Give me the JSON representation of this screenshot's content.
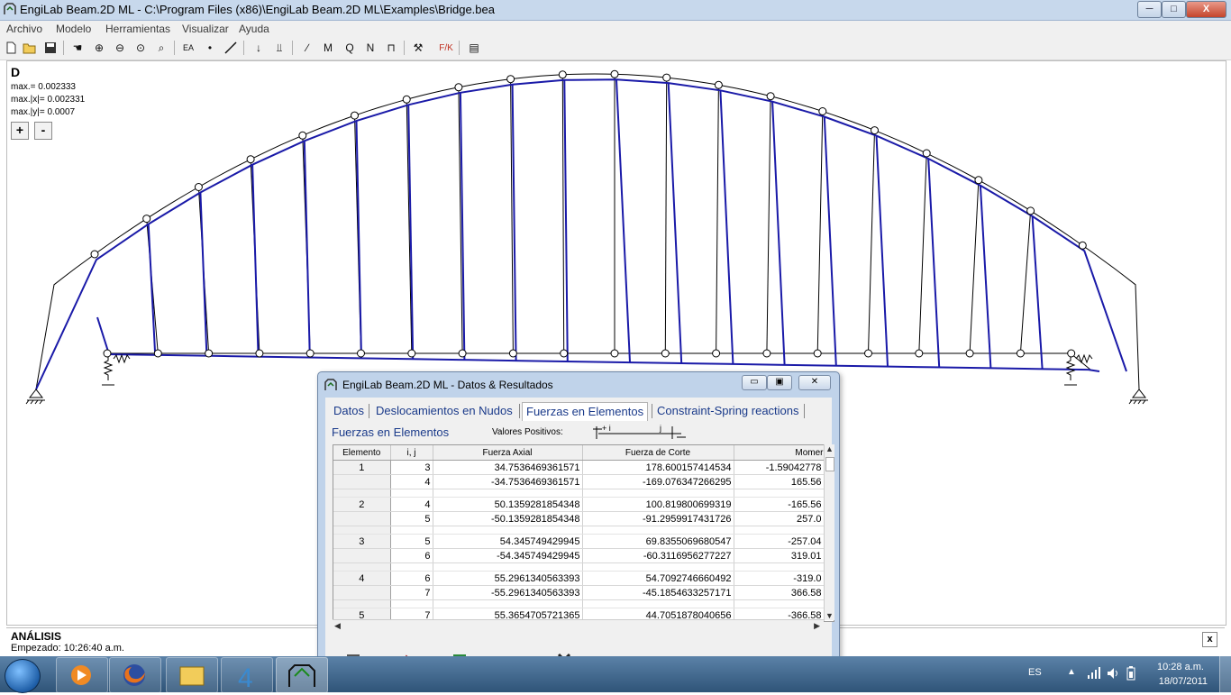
{
  "window": {
    "title": "EngiLab Beam.2D ML - C:\\Program Files (x86)\\EngiLab Beam.2D ML\\Examples\\Bridge.bea",
    "min_label": "─",
    "max_label": "□",
    "close_label": "X"
  },
  "menu": [
    "Archivo",
    "Modelo",
    "Herramientas",
    "Visualizar",
    "Ayuda"
  ],
  "canvas": {
    "view_label": "D",
    "max_total": "max.= 0.002333",
    "max_x": "max.|x|= 0.002331",
    "max_y": "max.|y|= 0.0007",
    "zoom_in": "+",
    "zoom_out": "-"
  },
  "analysis": {
    "heading": "ANÁLISIS",
    "started": "Empezado:  10:26:40 a.m.",
    "close": "x"
  },
  "dialog": {
    "title": "EngiLab Beam.2D ML - Datos & Resultados",
    "tabs": [
      "Datos",
      "Deslocamientos en Nudos",
      "Fuerzas en Elementos",
      "Constraint-Spring reactions"
    ],
    "active_tab": "Fuerzas en Elementos",
    "section_title": "Fuerzas en Elementos",
    "positive_values_label": "Valores Positivos:",
    "sign_i": "+ i",
    "sign_j": "j",
    "columns": [
      "Elemento",
      "i, j",
      "Fuerza Axial",
      "Fuerza de Corte",
      "Momer"
    ],
    "rows": [
      {
        "el": "1",
        "node": "3",
        "axial": "34.7536469361571",
        "shear": "178.600157414534",
        "moment": "-1.59042778"
      },
      {
        "el": "",
        "node": "4",
        "axial": "-34.7536469361571",
        "shear": "-169.076347266295",
        "moment": "165.56"
      },
      {
        "blank": true
      },
      {
        "el": "2",
        "node": "4",
        "axial": "50.1359281854348",
        "shear": "100.819800699319",
        "moment": "-165.56"
      },
      {
        "el": "",
        "node": "5",
        "axial": "-50.1359281854348",
        "shear": "-91.2959917431726",
        "moment": "257.0"
      },
      {
        "blank": true
      },
      {
        "el": "3",
        "node": "5",
        "axial": "54.345749429945",
        "shear": "69.8355069680547",
        "moment": "-257.04"
      },
      {
        "el": "",
        "node": "6",
        "axial": "-54.345749429945",
        "shear": "-60.3116956277227",
        "moment": "319.01"
      },
      {
        "blank": true
      },
      {
        "el": "4",
        "node": "6",
        "axial": "55.2961340563393",
        "shear": "54.7092746660492",
        "moment": "-319.0"
      },
      {
        "el": "",
        "node": "7",
        "axial": "-55.2961340563393",
        "shear": "-45.1854633257171",
        "moment": "366.58"
      },
      {
        "blank": true
      },
      {
        "el": "5",
        "node": "7",
        "axial": "55.3654705721365",
        "shear": "44.7051878040656",
        "moment": "-366.58"
      }
    ]
  },
  "taskbar": {
    "lang": "ES",
    "time": "10:28 a.m.",
    "date": "18/07/2011",
    "apps": [
      "media-player-icon",
      "firefox-icon",
      "explorer-icon",
      "app-4-icon",
      "engilab-icon"
    ]
  },
  "colors": {
    "deformed": "#1a1aa8",
    "original": "#000000",
    "titlebar": "#c7d8ec",
    "taskbar": "#2f5478"
  }
}
